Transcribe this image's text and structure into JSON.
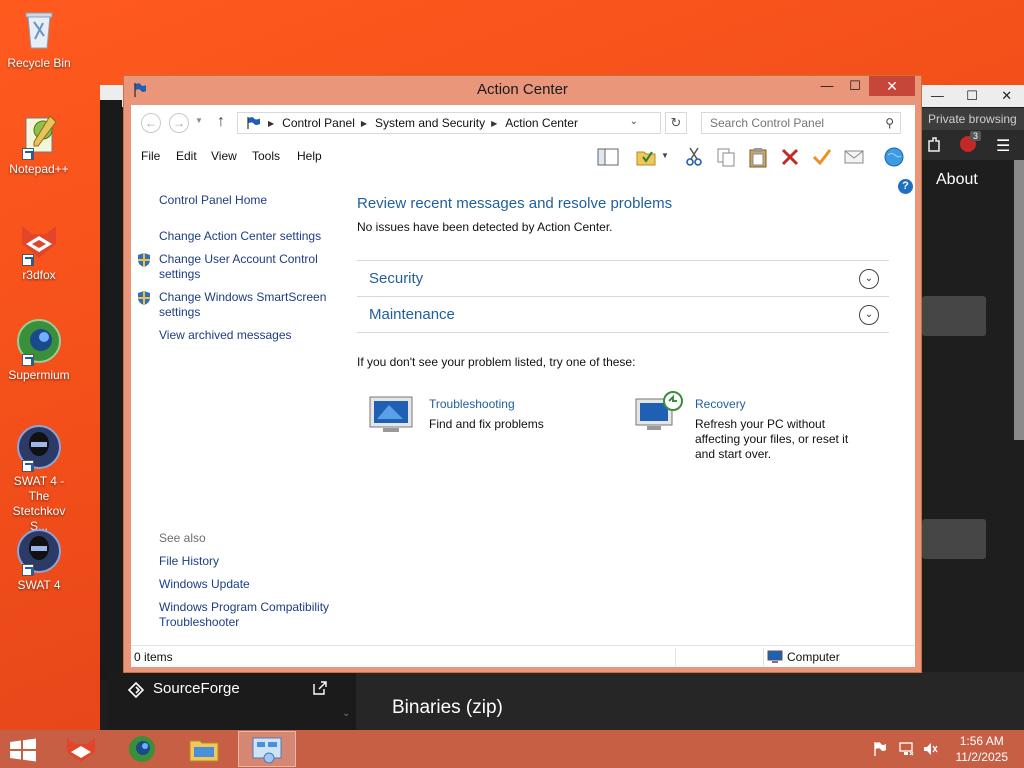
{
  "desktop": {
    "icons": [
      {
        "label": "Recycle Bin"
      },
      {
        "label": "Notepad++"
      },
      {
        "label": "r3dfox"
      },
      {
        "label": "Supermium"
      },
      {
        "label": "SWAT 4 - The Stetchkov S..."
      },
      {
        "label": "SWAT 4"
      }
    ]
  },
  "background_browser": {
    "private_label": "Private browsing",
    "about_label": "About",
    "sourceforge_label": "SourceForge",
    "binaries_label": "Binaries (zip)",
    "badge_count": "3"
  },
  "window": {
    "title": "Action Center",
    "controls": {
      "minimize": "—",
      "maximize": "☐",
      "close": "✕"
    }
  },
  "address": {
    "crumbs": [
      "Control Panel",
      "System and Security",
      "Action Center"
    ],
    "search_placeholder": "Search Control Panel"
  },
  "menu": {
    "items": [
      "File",
      "Edit",
      "View",
      "Tools",
      "Help"
    ]
  },
  "sidebar": {
    "home": "Control Panel Home",
    "links": [
      "Change Action Center settings",
      "Change User Account Control settings",
      "Change Windows SmartScreen settings",
      "View archived messages"
    ],
    "see_also_title": "See also",
    "see_also": [
      "File History",
      "Windows Update",
      "Windows Program Compatibility Troubleshooter"
    ]
  },
  "main": {
    "heading": "Review recent messages and resolve problems",
    "subtext": "No issues have been detected by Action Center.",
    "sections": [
      {
        "label": "Security"
      },
      {
        "label": "Maintenance"
      }
    ],
    "try_line": "If you don't see your problem listed, try one of these:",
    "tools": [
      {
        "title": "Troubleshooting",
        "desc": "Find and fix problems"
      },
      {
        "title": "Recovery",
        "desc": "Refresh your PC without affecting your files, or reset it and start over."
      }
    ]
  },
  "status": {
    "items": "0 items",
    "location": "Computer"
  },
  "taskbar": {
    "time": "1:56 AM",
    "date": "11/2/2025"
  },
  "colors": {
    "desktop_accent": "#f4501a",
    "link_blue": "#1f5f9e",
    "window_frame": "#e9967a"
  }
}
